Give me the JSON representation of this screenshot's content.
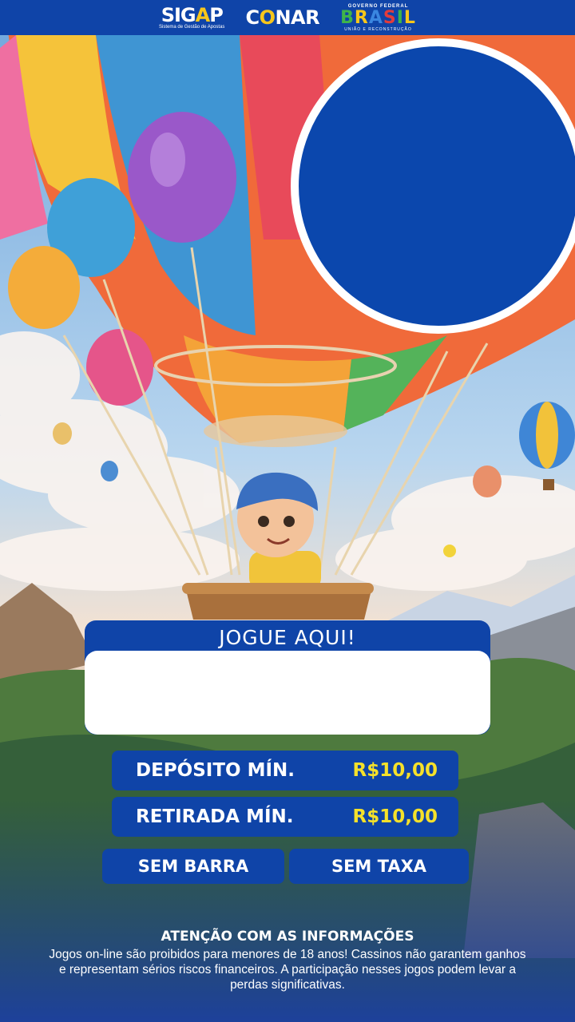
{
  "header": {
    "sigap": {
      "title_a": "SIG",
      "title_hl": "A",
      "title_b": "P",
      "subtitle": "Sistema de Gestão de Apostas"
    },
    "conar": {
      "a": "C",
      "hl": "O",
      "b": "NAR"
    },
    "governo": {
      "top": "GOVERNO FEDERAL",
      "letters": [
        "B",
        "R",
        "A",
        "S",
        "I",
        "L"
      ],
      "bottom": "UNIÃO E RECONSTRUÇÃO"
    }
  },
  "play": {
    "title": "JOGUE AQUI!"
  },
  "info": {
    "deposito_label": "DEPÓSITO MÍN.",
    "deposito_value": "R$10,00",
    "retirada_label": "RETIRADA MÍN.",
    "retirada_value": "R$10,00",
    "sem_barra": "SEM BARRA",
    "sem_taxa": "SEM TAXA"
  },
  "footer": {
    "heading": "ATENÇÃO COM AS INFORMAÇÕES",
    "text": "Jogos on-line são proibidos para menores de 18 anos! Cassinos não garantem ganhos e representam sérios riscos financeiros. A participação nesses jogos podem levar a perdas significativas."
  },
  "colors": {
    "brand_blue": "#0f44a8",
    "accent_yellow": "#f5e12a"
  }
}
